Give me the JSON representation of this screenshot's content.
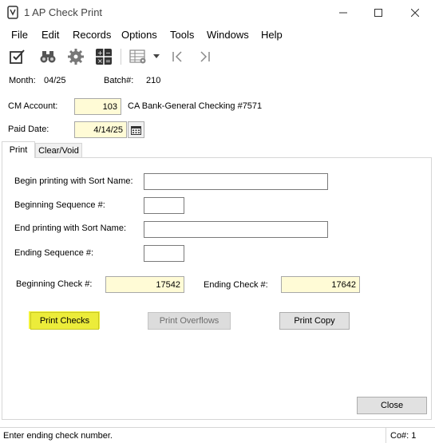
{
  "window": {
    "title": "1 AP Check Print",
    "minimize_label": "—",
    "maximize_label": "☐",
    "close_label": "✕"
  },
  "menu": {
    "items": [
      "File",
      "Edit",
      "Records",
      "Options",
      "Tools",
      "Windows",
      "Help"
    ]
  },
  "toolbar": {
    "icons": [
      "edit-check-icon",
      "binoculars-icon",
      "gear-icon",
      "calculator-icon",
      "grid-settings-icon",
      "dropdown-arrow-icon",
      "first-record-icon",
      "last-record-icon"
    ]
  },
  "header": {
    "month_label": "Month:",
    "month_value": "04/25",
    "batch_label": "Batch#:",
    "batch_value": "210",
    "cm_account_label": "CM Account:",
    "cm_account_value": "103",
    "cm_account_desc": "CA Bank-General Checking #7571",
    "paid_date_label": "Paid Date:",
    "paid_date_value": "4/14/25"
  },
  "tabs": {
    "print_label": "Print",
    "clear_void_label": "Clear/Void"
  },
  "form": {
    "begin_sort_label": "Begin printing with Sort Name:",
    "begin_sort_value": "",
    "begin_seq_label": "Beginning Sequence #:",
    "begin_seq_value": "",
    "end_sort_label": "End printing with Sort Name:",
    "end_sort_value": "",
    "end_seq_label": "Ending Sequence #:",
    "end_seq_value": "",
    "begin_check_label": "Beginning Check #:",
    "begin_check_value": "17542",
    "end_check_label": "Ending Check #:",
    "end_check_value": "17642"
  },
  "buttons": {
    "print_checks": "Print Checks",
    "print_overflows": "Print Overflows",
    "print_copy": "Print Copy",
    "close": "Close"
  },
  "status": {
    "message": "Enter ending check number.",
    "company": "Co#: 1"
  },
  "colors": {
    "highlight": "#f2f23a",
    "input_yellow": "#fffbd6"
  }
}
